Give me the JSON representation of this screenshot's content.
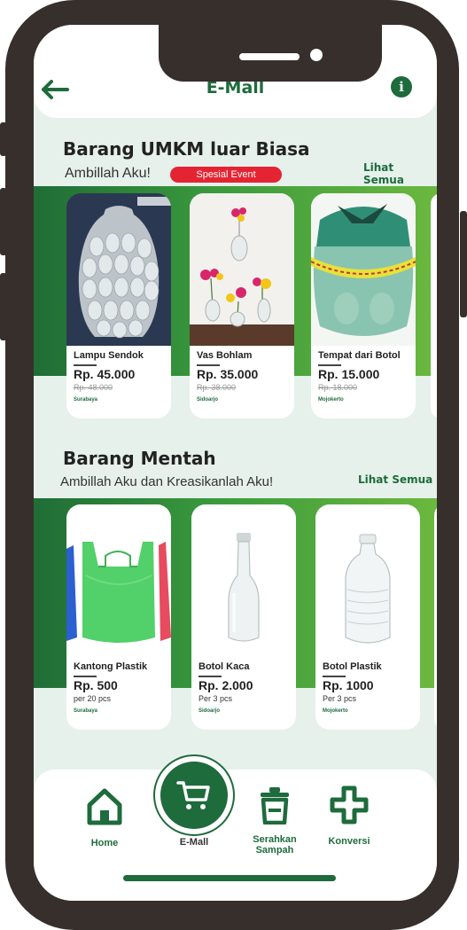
{
  "header": {
    "title": "E-Mall"
  },
  "section_umkm": {
    "title": "Barang UMKM luar Biasa",
    "subtitle": "Ambillah Aku!",
    "badge": "Spesial Event",
    "see_all": "Lihat Semua",
    "products": [
      {
        "name": "Lampu Sendok",
        "price": "Rp. 45.000",
        "old_price": "Rp. 48.000",
        "city": "Surabaya"
      },
      {
        "name": "Vas Bohlam",
        "price": "Rp. 35.000",
        "old_price": "Rp. 38.000",
        "city": "Sidoarjo"
      },
      {
        "name": "Tempat dari Botol",
        "price": "Rp. 15.000",
        "old_price": "Rp. 18.000",
        "city": "Mojokerto"
      }
    ]
  },
  "section_raw": {
    "title": "Barang Mentah",
    "subtitle": "Ambillah Aku dan Kreasikanlah Aku!",
    "see_all": "Lihat Semua",
    "products": [
      {
        "name": "Kantong Plastik",
        "price": "Rp. 500",
        "unit": "per 20 pcs",
        "city": "Surabaya"
      },
      {
        "name": "Botol Kaca",
        "price": "Rp. 2.000",
        "unit": "Per 3 pcs",
        "city": "Sidoarjo"
      },
      {
        "name": "Botol Plastik",
        "price": "Rp. 1000",
        "unit": "Per 3 pcs",
        "city": "Mojokerto"
      }
    ]
  },
  "bottom_nav": {
    "items": [
      {
        "label": "Home",
        "icon": "home-icon"
      },
      {
        "label": "E-Mall",
        "icon": "cart-icon"
      },
      {
        "label": "Serahkan Sampah",
        "icon": "trash-icon"
      },
      {
        "label": "Konversi",
        "icon": "plus-icon"
      }
    ]
  },
  "colors": {
    "primary": "#1e6b3c",
    "badge": "#e52433",
    "band_start": "#1f6d36",
    "band_end": "#6bb83e",
    "background": "#e6f1ec"
  }
}
